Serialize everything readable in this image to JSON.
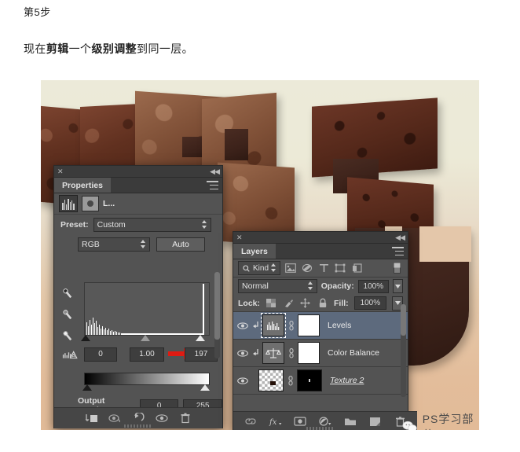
{
  "article": {
    "step_label": "第5步",
    "lead_prefix": "现在",
    "lead_bold1": "剪辑",
    "lead_mid": "一个",
    "lead_bold2": "级别调整",
    "lead_suffix": "到同一层。"
  },
  "properties_panel": {
    "close_icon": "close-icon",
    "collapse_icon": "collapse-icon",
    "tab_label": "Properties",
    "adjustment_title": "L...",
    "preset_label": "Preset:",
    "preset_value": "Custom",
    "channel_value": "RGB",
    "auto_label": "Auto",
    "input_black": "0",
    "input_gamma": "1.00",
    "input_white": "197",
    "output_label": "Output Levels:",
    "output_black": "0",
    "output_white": "255",
    "footer_icons": [
      "clip-to-layer-icon",
      "previous-state-icon",
      "reset-icon",
      "visibility-icon",
      "delete-icon"
    ],
    "eyedroppers": [
      "black-point-eyedropper",
      "gray-point-eyedropper",
      "white-point-eyedropper"
    ],
    "arrow_color": "#e01b12"
  },
  "layers_panel": {
    "close_icon": "close-icon",
    "collapse_icon": "collapse-icon",
    "tab_label": "Layers",
    "filter_kind": "Kind",
    "filter_icons": [
      "pixel-filter-icon",
      "adjustment-filter-icon",
      "type-filter-icon",
      "shape-filter-icon",
      "smart-object-filter-icon"
    ],
    "blend_mode": "Normal",
    "opacity_label": "Opacity:",
    "opacity_value": "100%",
    "lock_label": "Lock:",
    "lock_icons": [
      "lock-transparency-icon",
      "lock-image-icon",
      "lock-position-icon",
      "lock-all-icon"
    ],
    "fill_label": "Fill:",
    "fill_value": "100%",
    "layers": [
      {
        "name": "Levels",
        "selected": true,
        "clipped": true,
        "style": "normal"
      },
      {
        "name": "Color Balance",
        "selected": false,
        "clipped": true,
        "style": "normal"
      },
      {
        "name": "Texture 2",
        "selected": false,
        "clipped": false,
        "style": "italic-underline"
      }
    ],
    "footer_icons": [
      "link-layers-icon",
      "layer-style-icon",
      "layer-mask-icon",
      "adjustment-layer-icon",
      "new-group-icon",
      "new-layer-icon",
      "delete-layer-icon"
    ],
    "selection_accent": "#5d6a7d"
  },
  "watermark": {
    "icon": "wechat-icon",
    "text": "PS学习部落"
  },
  "canvas": {
    "background_top": "#ecead9",
    "background_bottom": "#e2bb98",
    "subject": "chocolate-brownie-3d-letters"
  }
}
